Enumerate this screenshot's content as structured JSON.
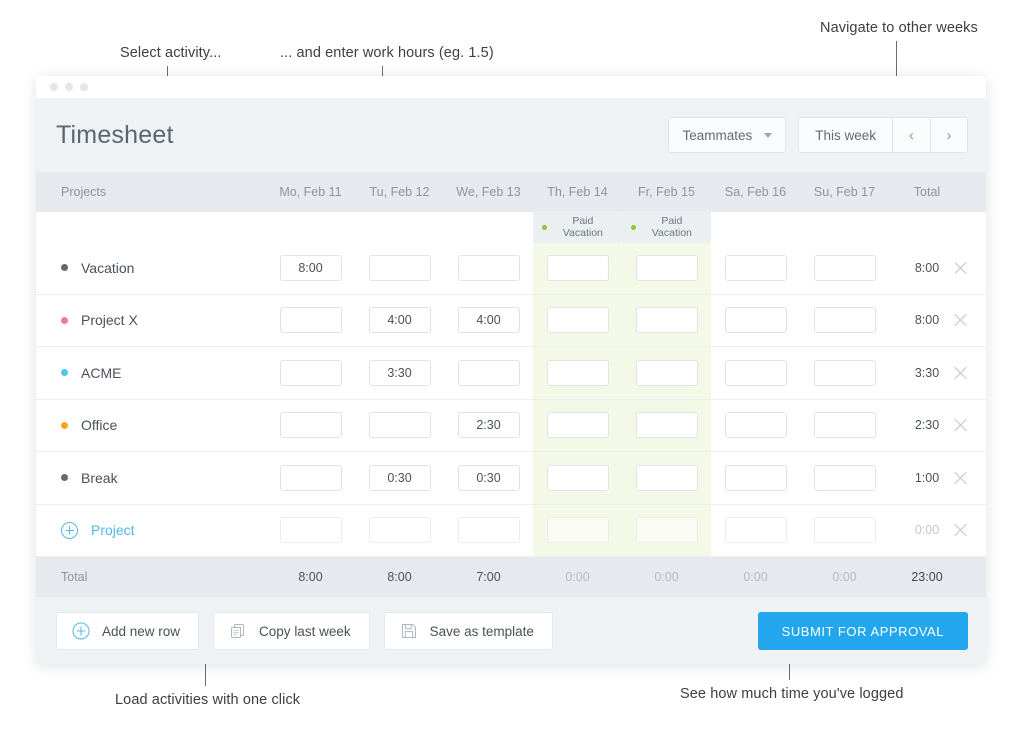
{
  "annotations": [
    {
      "id": "select-activity",
      "text": "Select activity..."
    },
    {
      "id": "enter-hours",
      "text": "... and enter work hours (eg. 1.5)"
    },
    {
      "id": "navigate-weeks",
      "text": "Navigate to other weeks"
    },
    {
      "id": "load-activities",
      "text": "Load activities with one click"
    },
    {
      "id": "time-logged",
      "text": "See how much time you've logged"
    }
  ],
  "app": {
    "title": "Timesheet",
    "teammates_label": "Teammates",
    "week_label": "This week",
    "prev_arrow": "‹",
    "next_arrow": "›"
  },
  "table": {
    "columns": [
      "Projects",
      "Mo, Feb 11",
      "Tu, Feb 12",
      "We, Feb 13",
      "Th, Feb 14",
      "Fr, Feb 15",
      "Sa, Feb 16",
      "Su, Feb 17",
      "Total"
    ],
    "badges": [
      {
        "day_index": 3,
        "label": "Paid Vacation",
        "color": "#8fc63d"
      },
      {
        "day_index": 4,
        "label": "Paid Vacation",
        "color": "#8fc63d"
      }
    ],
    "rows": [
      {
        "name": "Vacation",
        "color": "#5d6b75",
        "hours": [
          "8:00",
          "",
          "",
          "",
          "",
          "",
          ""
        ],
        "total": "8:00",
        "add_row": false
      },
      {
        "name": "Project X",
        "color": "#f8749a",
        "hours": [
          "",
          "4:00",
          "4:00",
          "",
          "",
          "",
          ""
        ],
        "total": "8:00",
        "add_row": false
      },
      {
        "name": "ACME",
        "color": "#4ec3f7",
        "hours": [
          "",
          "3:30",
          "",
          "",
          "",
          "",
          ""
        ],
        "total": "3:30",
        "add_row": false
      },
      {
        "name": "Office",
        "color": "#f5a623",
        "hours": [
          "",
          "",
          "2:30",
          "",
          "",
          "",
          ""
        ],
        "total": "2:30",
        "add_row": false
      },
      {
        "name": "Break",
        "color": "#5d6b75",
        "hours": [
          "",
          "0:30",
          "0:30",
          "",
          "",
          "",
          ""
        ],
        "total": "1:00",
        "add_row": false
      },
      {
        "name": "Project",
        "color": "#4fb9ea",
        "hours": [
          "",
          "",
          "",
          "",
          "",
          "",
          ""
        ],
        "total": "0:00",
        "add_row": true
      }
    ],
    "totals_label": "Total",
    "day_totals": [
      "8:00",
      "8:00",
      "7:00",
      "0:00",
      "0:00",
      "0:00",
      "0:00"
    ],
    "grand_total": "23:00"
  },
  "footer": {
    "add_row_label": "Add new row",
    "copy_week_label": "Copy last week",
    "save_template_label": "Save as template",
    "submit_label": "SUBMIT FOR APPROVAL"
  },
  "colors": {
    "accent": "#22a7ee",
    "link": "#4fb9ea",
    "vacation_band": "#f3f8e7",
    "header_bg": "#e6eaee",
    "chrome_bg": "#eef2f5"
  }
}
